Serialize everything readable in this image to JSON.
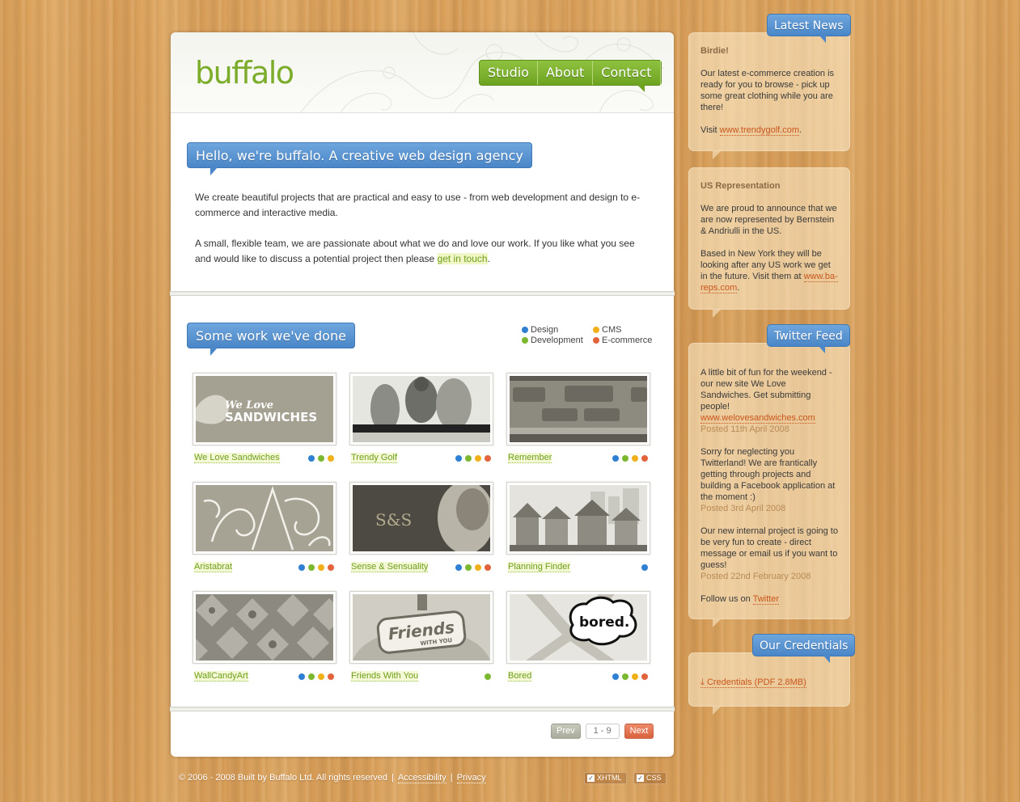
{
  "brand": {
    "logo": "buffalo"
  },
  "nav": [
    {
      "label": "Studio"
    },
    {
      "label": "About"
    },
    {
      "label": "Contact"
    }
  ],
  "intro": {
    "heading": "Hello, we're buffalo. A creative web design agency",
    "p1": "We create beautiful projects that are practical and easy to use - from web development and design to e-commerce and interactive media.",
    "p2_before": "A small, flexible team, we are passionate about what we do and love our work. If you like what you see and would like to discuss a potential project then please ",
    "p2_link": "get in touch",
    "p2_after": "."
  },
  "work": {
    "heading": "Some work we've done",
    "legend": [
      {
        "label": "Design",
        "color": "#2f7fd3"
      },
      {
        "label": "CMS",
        "color": "#f0b01a"
      },
      {
        "label": "Development",
        "color": "#7cb82f"
      },
      {
        "label": "E-commerce",
        "color": "#e2633c"
      }
    ],
    "items": [
      {
        "name": "We Love Sandwiches",
        "dots": [
          "#2f7fd3",
          "#7cb82f",
          "#f0b01a"
        ]
      },
      {
        "name": "Trendy Golf",
        "dots": [
          "#2f7fd3",
          "#7cb82f",
          "#f0b01a",
          "#e2633c"
        ]
      },
      {
        "name": "Remember",
        "dots": [
          "#2f7fd3",
          "#7cb82f",
          "#f0b01a",
          "#e2633c"
        ]
      },
      {
        "name": "Aristabrat",
        "dots": [
          "#2f7fd3",
          "#7cb82f",
          "#f0b01a",
          "#e2633c"
        ]
      },
      {
        "name": "Sense & Sensuality",
        "dots": [
          "#2f7fd3",
          "#7cb82f",
          "#f0b01a",
          "#e2633c"
        ]
      },
      {
        "name": "Planning Finder",
        "dots": [
          "#2f7fd3"
        ]
      },
      {
        "name": "WallCandyArt",
        "dots": [
          "#2f7fd3",
          "#7cb82f",
          "#f0b01a",
          "#e2633c"
        ]
      },
      {
        "name": "Friends With You",
        "dots": [
          "#7cb82f"
        ]
      },
      {
        "name": "Bored",
        "dots": [
          "#2f7fd3",
          "#7cb82f",
          "#f0b01a",
          "#e2633c"
        ]
      }
    ],
    "thumb_text": {
      "sandwiches_1": "We Love",
      "sandwiches_2": "SANDWICHES",
      "sense": "S&S",
      "friends_1": "Friends",
      "friends_2": "WITH YOU",
      "bored": "bored."
    }
  },
  "pager": {
    "prev": "Prev",
    "pages": "1 - 9",
    "next": "Next"
  },
  "footer": {
    "copyright": "© 2006 - 2008 Built by Buffalo Ltd. All rights reserved",
    "accessibility": "Accessibility",
    "privacy": "Privacy",
    "xhtml": "XHTML",
    "css": "CSS"
  },
  "sidebar": {
    "latest_news_title": "Latest News",
    "news": [
      {
        "title": "Birdie!",
        "p1": "Our latest e-commerce creation is ready for you to browse - pick up some great clothing while you are there!",
        "p2_before": "Visit ",
        "link": "www.trendygolf.com",
        "p2_after": "."
      },
      {
        "title": "US Representation",
        "p1": "We are proud to announce that we are now represented by Bernstein & Andriulli in the US.",
        "p2": "Based in New York they will be looking after any US work we get in the future. Visit them at",
        "link": "www.ba-reps.com",
        "link_after": "."
      }
    ],
    "twitter_title": "Twitter Feed",
    "tweets": [
      {
        "text": "A little bit of fun for the weekend - our new site We Love Sandwiches. Get submitting people!",
        "link": "www.welovesandwiches.com",
        "posted": "Posted 11th April 2008"
      },
      {
        "text": "Sorry for neglecting you Twitterland! We are frantically getting through projects and building a Facebook application at the moment :)",
        "posted": "Posted 3rd April 2008"
      },
      {
        "text": "Our new internal project is going to be very fun to create - direct message or email us if you want to guess!",
        "posted": "Posted 22nd February 2008"
      }
    ],
    "follow_before": "Follow us on ",
    "follow_link": "Twitter",
    "credentials_title": "Our Credentials",
    "credentials_link": "Credentials (PDF 2.8MB)"
  }
}
